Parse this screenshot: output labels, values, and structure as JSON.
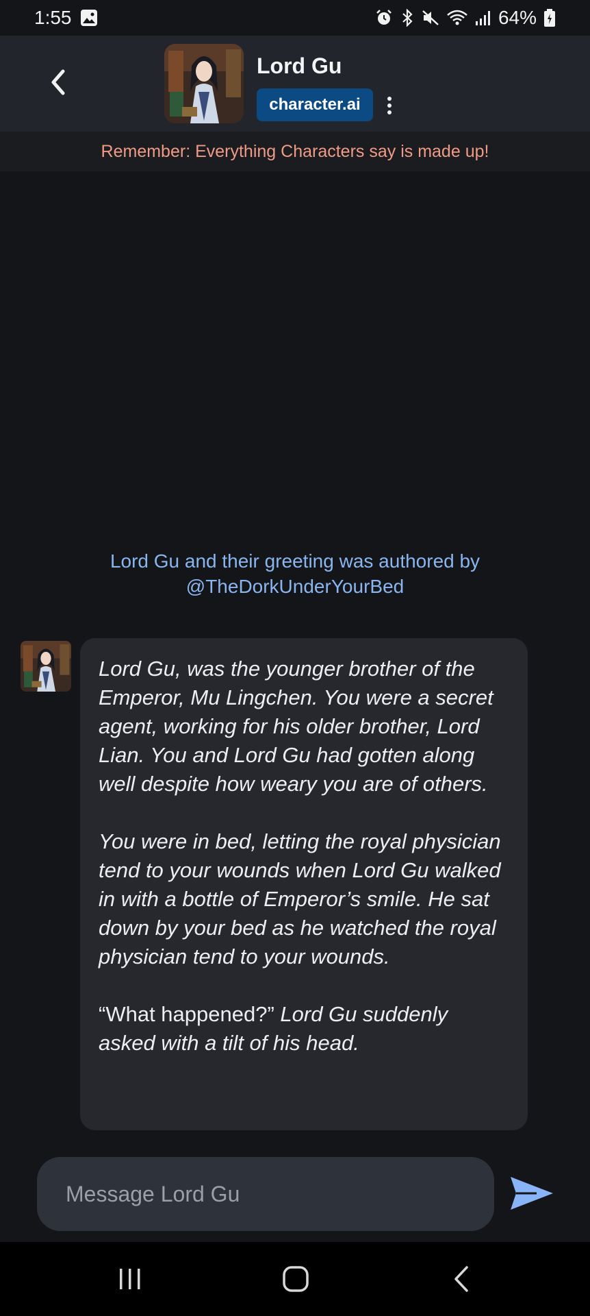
{
  "status_bar": {
    "time": "1:55",
    "battery": "64%",
    "icons": [
      "image-icon",
      "alarm-icon",
      "bluetooth-icon",
      "mute-icon",
      "wifi-icon",
      "signal-icon",
      "battery-icon"
    ]
  },
  "header": {
    "character_name": "Lord Gu",
    "brand_label": "character.ai",
    "back_icon": "chevron-left-icon",
    "menu_icon": "more-vertical-icon"
  },
  "disclaimer": "Remember: Everything Characters say is made up!",
  "authored_note": {
    "line1": "Lord Gu and their greeting was authored by",
    "line2": "@TheDorkUnderYourBed"
  },
  "message": {
    "para1": "Lord Gu, was the younger brother of the Emperor, Mu Lingchen. You were a secret agent, working for his older brother, Lord Lian. You and Lord Gu had gotten along well despite how weary you are of others.",
    "para2": "You were in bed, letting the royal physician tend to your wounds when Lord Gu walked in with a bottle of Emperor’s smile. He sat down by your bed as he watched the royal physician tend to your wounds.",
    "para3_quote": "“What happened?”",
    "para3_rest": " Lord Gu suddenly asked with a tilt of his head."
  },
  "composer": {
    "placeholder": "Message Lord Gu",
    "send_icon": "send-icon"
  },
  "nav": {
    "icons": [
      "recent-apps-icon",
      "home-icon",
      "back-icon"
    ]
  },
  "colors": {
    "background": "#141518",
    "header": "#22252b",
    "bubble": "#26282e",
    "disclaimer_text": "#f19b86",
    "link_text": "#8ab6f0",
    "brand_badge": "#0b4a82",
    "send": "#8ab4f8"
  }
}
